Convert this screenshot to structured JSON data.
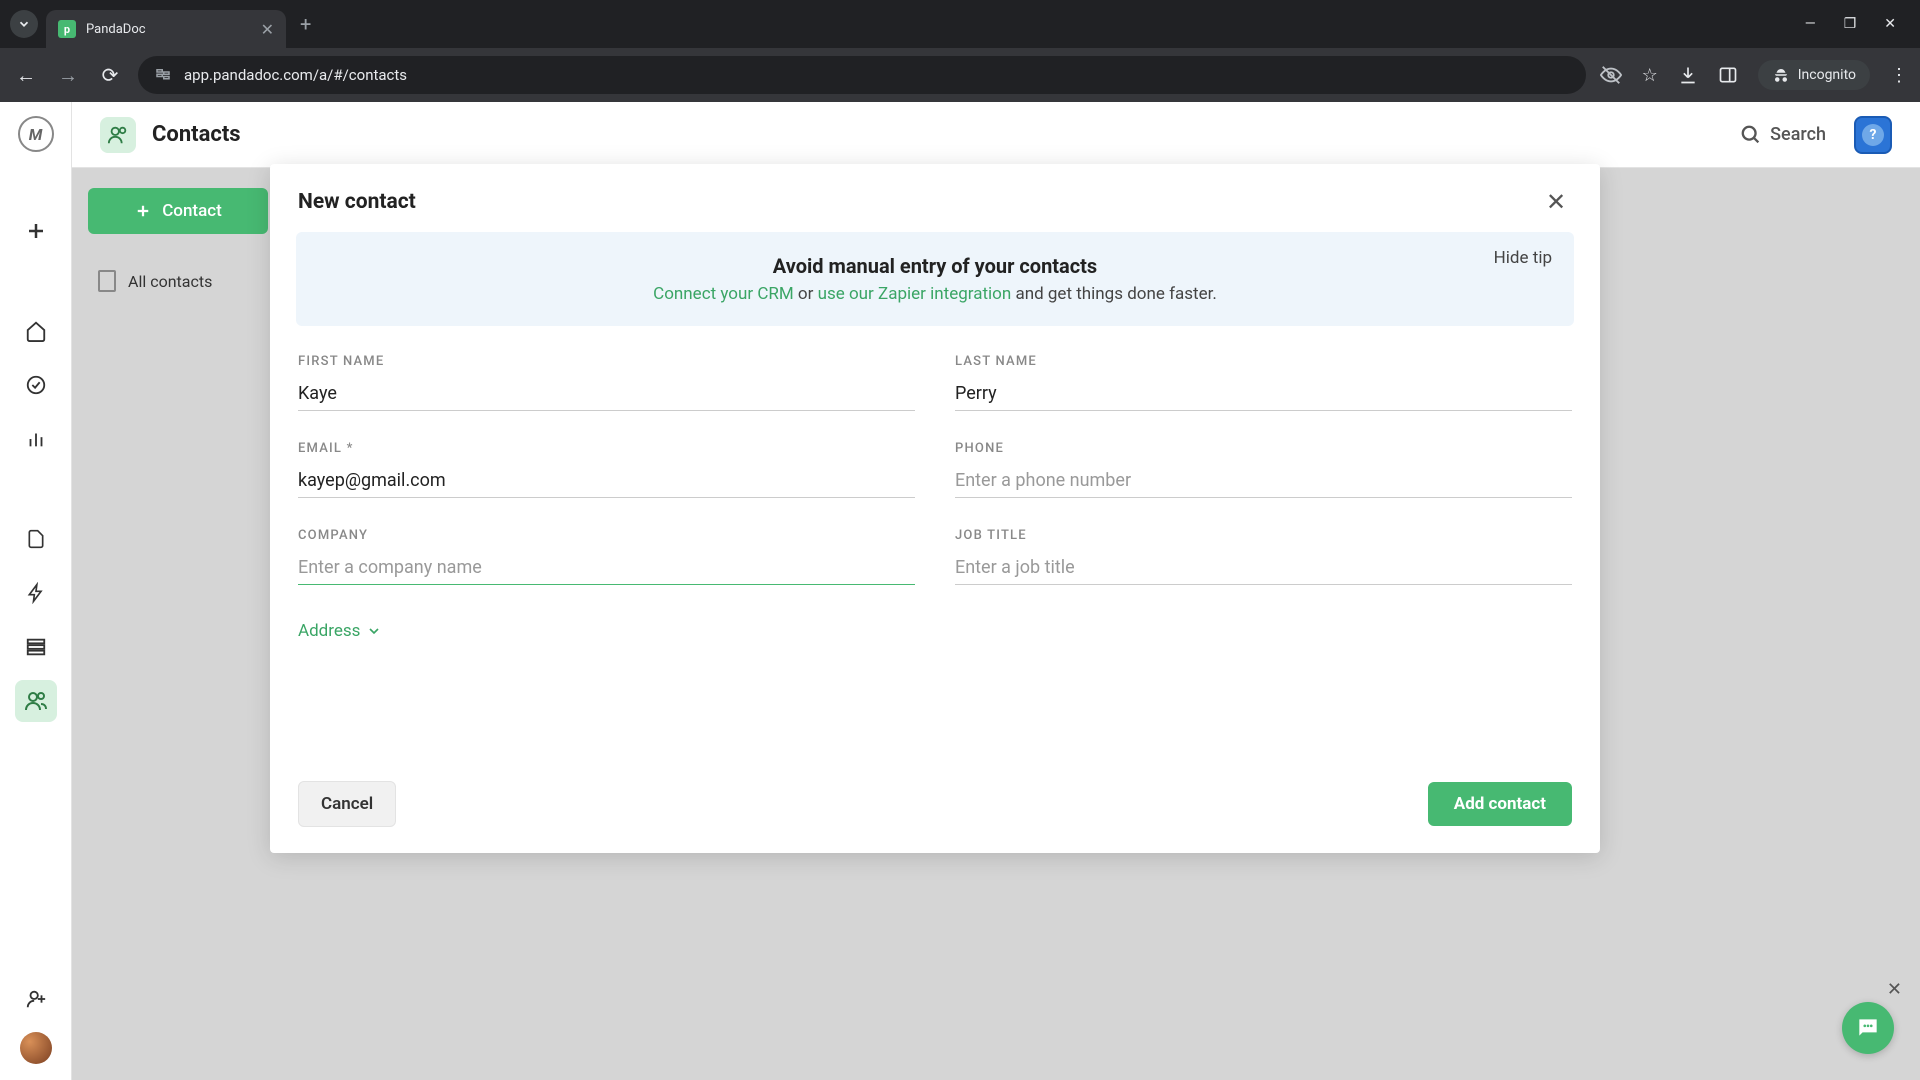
{
  "browser": {
    "tab_title": "PandaDoc",
    "url": "app.pandadoc.com/a/#/contacts",
    "incognito_label": "Incognito"
  },
  "header": {
    "title": "Contacts",
    "search_label": "Search"
  },
  "sidebar": {
    "new_contact_btn": "Contact",
    "all_contacts": "All contacts"
  },
  "modal": {
    "title": "New contact",
    "tip": {
      "hide": "Hide tip",
      "title": "Avoid manual entry of your contacts",
      "connect": "Connect your CRM",
      "or": " or ",
      "zapier": "use our Zapier integration",
      "rest": " and get things done faster."
    },
    "fields": {
      "first_name": {
        "label": "FIRST NAME",
        "value": "Kaye"
      },
      "last_name": {
        "label": "LAST NAME",
        "value": "Perry"
      },
      "email": {
        "label": "EMAIL *",
        "value": "kayep@gmail.com"
      },
      "phone": {
        "label": "PHONE",
        "placeholder": "Enter a phone number",
        "value": ""
      },
      "company": {
        "label": "COMPANY",
        "placeholder": "Enter a company name",
        "value": ""
      },
      "job_title": {
        "label": "JOB TITLE",
        "placeholder": "Enter a job title",
        "value": ""
      }
    },
    "address_toggle": "Address",
    "cancel": "Cancel",
    "submit": "Add contact"
  }
}
